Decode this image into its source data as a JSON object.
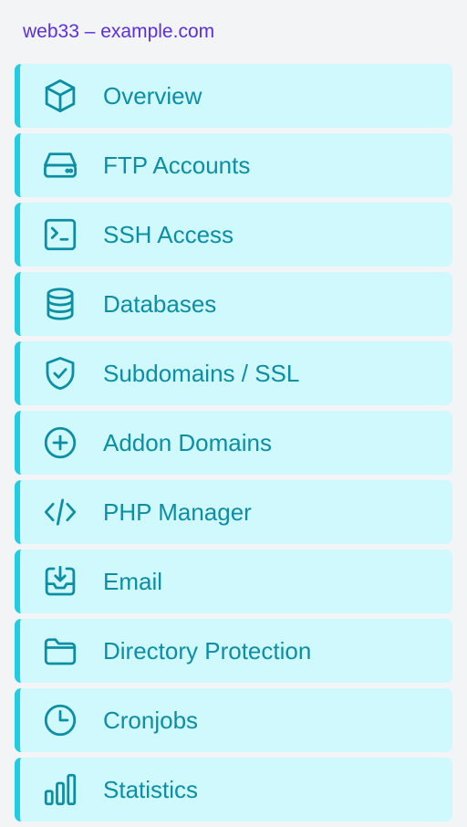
{
  "header": {
    "title": "web33 – example.com"
  },
  "colors": {
    "title": "#5b2ee6",
    "item_bg": "#cff9fd",
    "item_accent": "#22cde3",
    "item_text": "#0c8ea5",
    "page_bg": "#f3f4f6"
  },
  "menu": {
    "items": [
      {
        "label": "Overview",
        "icon": "cube-icon"
      },
      {
        "label": "FTP Accounts",
        "icon": "hard-drive-icon"
      },
      {
        "label": "SSH Access",
        "icon": "terminal-icon"
      },
      {
        "label": "Databases",
        "icon": "database-icon"
      },
      {
        "label": "Subdomains / SSL",
        "icon": "shield-check-icon"
      },
      {
        "label": "Addon Domains",
        "icon": "plus-circle-icon"
      },
      {
        "label": "PHP Manager",
        "icon": "code-icon"
      },
      {
        "label": "Email",
        "icon": "inbox-download-icon"
      },
      {
        "label": "Directory Protection",
        "icon": "folder-icon"
      },
      {
        "label": "Cronjobs",
        "icon": "clock-icon"
      },
      {
        "label": "Statistics",
        "icon": "bar-chart-icon"
      }
    ]
  }
}
